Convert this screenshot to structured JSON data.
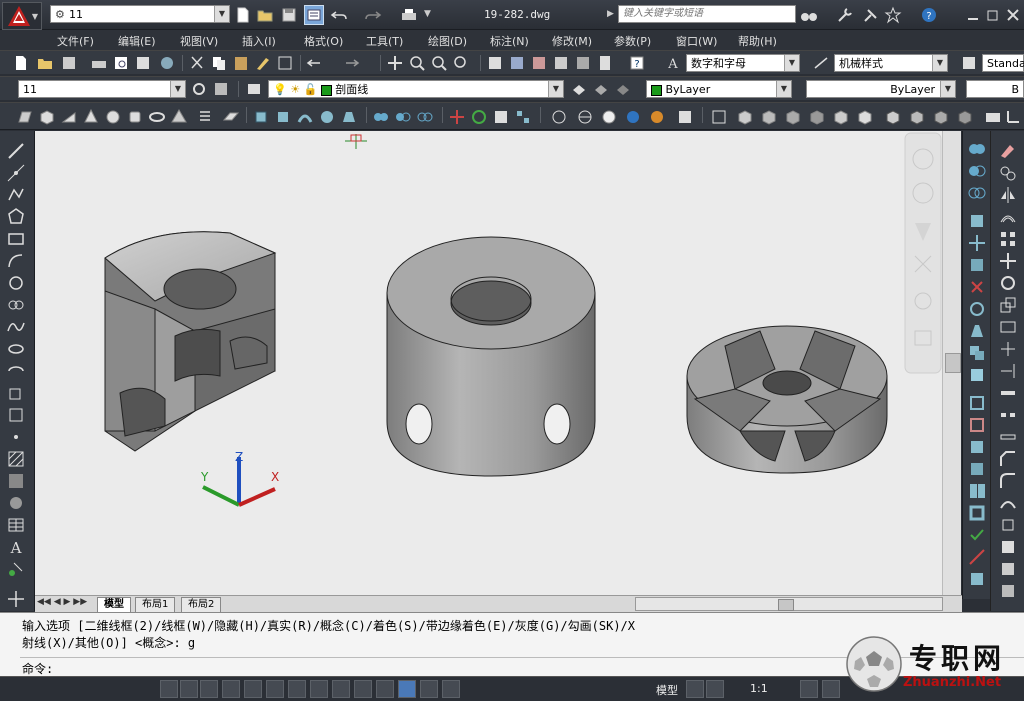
{
  "app": {
    "title": "19-282.dwg",
    "workspace": "11",
    "search_placeholder": "键入关键字或短语",
    "accent": "#c0201e"
  },
  "menu": [
    {
      "label": "文件(F)"
    },
    {
      "label": "编辑(E)"
    },
    {
      "label": "视图(V)"
    },
    {
      "label": "插入(I)"
    },
    {
      "label": "格式(O)"
    },
    {
      "label": "工具(T)"
    },
    {
      "label": "绘图(D)"
    },
    {
      "label": "标注(N)"
    },
    {
      "label": "修改(M)"
    },
    {
      "label": "参数(P)"
    },
    {
      "label": "窗口(W)"
    },
    {
      "label": "帮助(H)"
    }
  ],
  "toolbar1": {
    "text_style": "数字和字母",
    "dim_style": "机械样式",
    "table_style": "Standa"
  },
  "toolbar2": {
    "view_combo": "11",
    "layer_combo": "剖面线",
    "color_combo": "ByLayer",
    "linetype_combo": "ByLayer",
    "lineweight_combo": "B"
  },
  "ucs": {
    "x": "X",
    "y": "Y",
    "z": "Z"
  },
  "tabs": [
    {
      "label": "模型"
    },
    {
      "label": "布局1"
    },
    {
      "label": "布局2"
    }
  ],
  "command": {
    "line1": "输入选项 [二维线框(2)/线框(W)/隐藏(H)/真实(R)/概念(C)/着色(S)/带边缘着色(E)/灰度(G)/勾画(SK)/X",
    "line2": "射线(X)/其他(O)] <概念>: g",
    "prompt": "命令:"
  },
  "status": {
    "model_label": "模型",
    "scale": "1:1"
  },
  "watermark": {
    "title": "专职网",
    "url": "Zhuanzhi.Net"
  }
}
